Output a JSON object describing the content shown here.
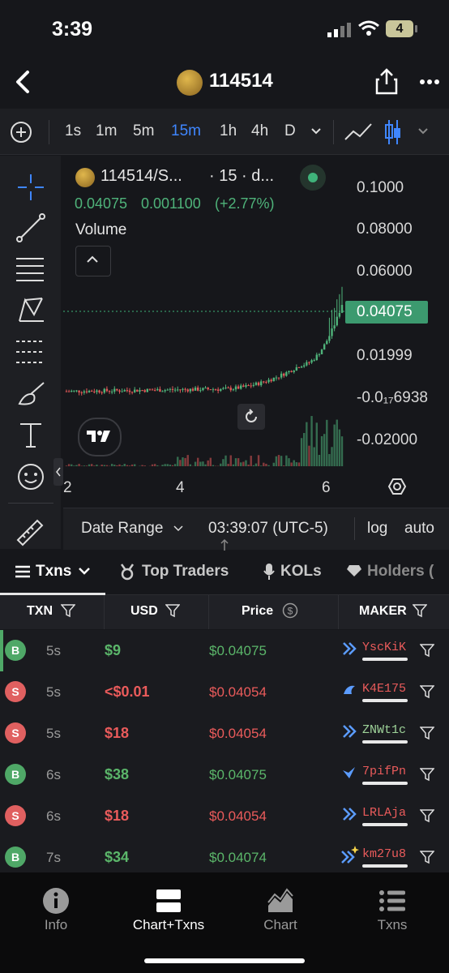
{
  "status_bar": {
    "time": "3:39",
    "battery": "4"
  },
  "header": {
    "title": "114514"
  },
  "intervals": {
    "items": [
      "1s",
      "1m",
      "5m",
      "15m",
      "1h",
      "4h",
      "D"
    ],
    "active": "15m"
  },
  "chart": {
    "symbol": "114514/S...",
    "interval_info": "· 15 · d...",
    "last": "0.04075",
    "change": "0.001100",
    "change_pct": "(+2.77%)",
    "volume_label": "Volume",
    "y_ticks": [
      "0.1000",
      "0.08000",
      "0.06000",
      "0.01999",
      "-0.0₁₇6938",
      "-0.02000"
    ],
    "price_tag": "0.04075",
    "x_ticks": [
      "2",
      "4",
      "6"
    ],
    "date_range": "Date Range",
    "clock": "03:39:07 (UTC-5)",
    "log": "log",
    "auto": "auto",
    "up_color": "#4fb37a",
    "down_color": "#e05858"
  },
  "chart_data": {
    "type": "line",
    "title": "",
    "x": [
      "2",
      "4",
      "6"
    ],
    "series": [
      {
        "values": [
          0.0,
          0.0,
          0.001,
          0.004,
          0.008,
          0.016,
          0.042,
          0.055,
          0.04075
        ]
      }
    ],
    "ylabel": "",
    "xlabel": ""
  },
  "tabs": {
    "items": [
      "Txns",
      "Top Traders",
      "KOLs",
      "Holders ("
    ],
    "active": "Txns"
  },
  "table": {
    "headers": [
      "TXN",
      "USD",
      "Price",
      "MAKER"
    ],
    "rows": [
      {
        "side": "B",
        "age": "5s",
        "usd": "$9",
        "price": "$0.04075",
        "maker": "YscKiK"
      },
      {
        "side": "S",
        "age": "5s",
        "usd": "<$0.01",
        "price": "$0.04054",
        "maker": "K4E175"
      },
      {
        "side": "S",
        "age": "5s",
        "usd": "$18",
        "price": "$0.04054",
        "maker": "ZNWt1c"
      },
      {
        "side": "B",
        "age": "6s",
        "usd": "$38",
        "price": "$0.04075",
        "maker": "7pifPn"
      },
      {
        "side": "S",
        "age": "6s",
        "usd": "$18",
        "price": "$0.04054",
        "maker": "LRLAja"
      },
      {
        "side": "B",
        "age": "7s",
        "usd": "$34",
        "price": "$0.04074",
        "maker": "km27u8"
      }
    ]
  },
  "bottom_nav": {
    "items": [
      "Info",
      "Chart+Txns",
      "Chart",
      "Txns"
    ],
    "active": "Chart+Txns"
  }
}
